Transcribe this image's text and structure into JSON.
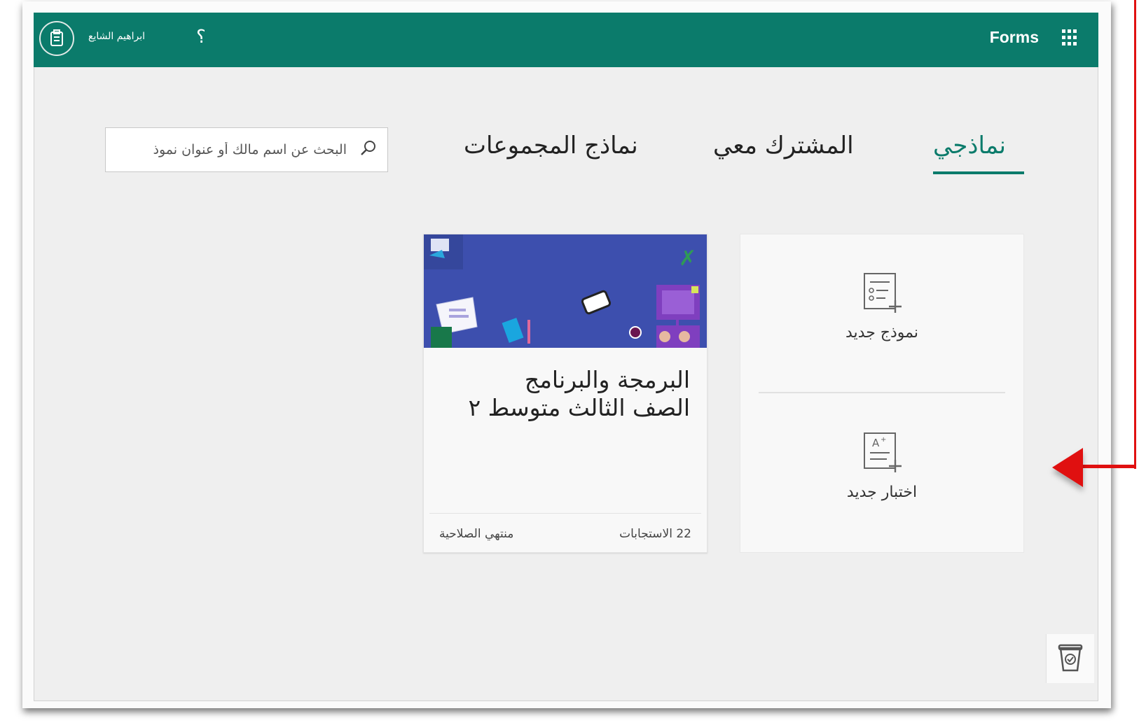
{
  "header": {
    "app_title": "Forms",
    "username": "ابراهيم الشايع",
    "help": "؟"
  },
  "tabs": [
    {
      "label": "نماذجي",
      "active": true
    },
    {
      "label": "المشترك معي",
      "active": false
    },
    {
      "label": "نماذج المجموعات",
      "active": false
    }
  ],
  "search": {
    "placeholder": "البحث عن اسم مالك أو عنوان نموذ"
  },
  "new_options": {
    "new_form": "نموذج جديد",
    "new_quiz": "اختبار جديد"
  },
  "form_card": {
    "title_line1": "البرمجة والبرنامج",
    "title_line2": "الصف الثالث متوسط ٢",
    "responses": "22 الاستجابات",
    "status": "منتهي الصلاحية"
  },
  "colors": {
    "brand": "#0b7b6b",
    "banner": "#3d4fae",
    "annotation": "#e01010"
  },
  "icons": [
    "waffle-icon",
    "help-icon",
    "avatar-icon",
    "search-icon",
    "new-form-icon",
    "new-quiz-icon",
    "badge-icon"
  ]
}
